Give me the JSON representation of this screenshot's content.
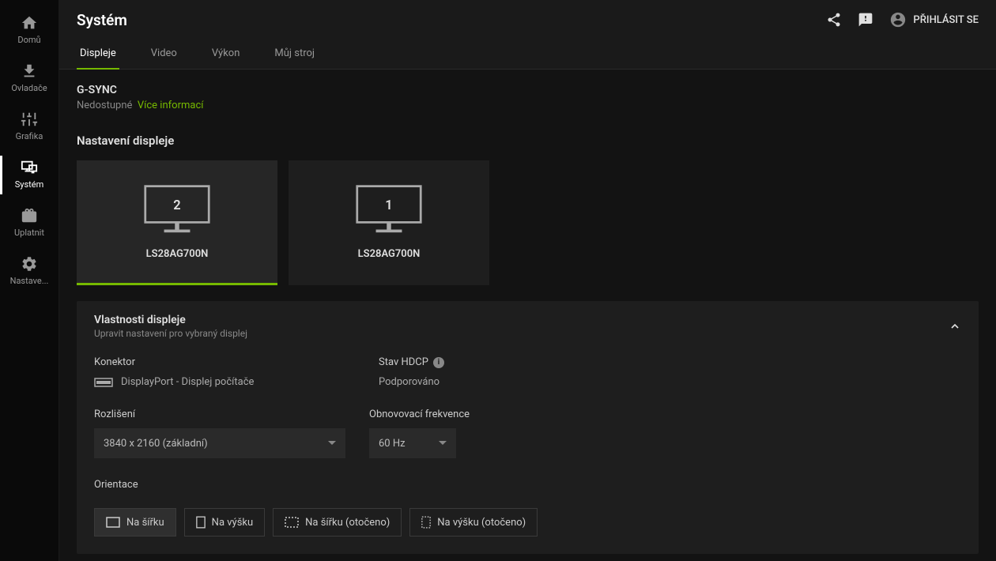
{
  "sidebar": {
    "items": [
      {
        "label": "Domů"
      },
      {
        "label": "Ovladače"
      },
      {
        "label": "Grafika"
      },
      {
        "label": "Systém"
      },
      {
        "label": "Uplatnit"
      },
      {
        "label": "Nastave..."
      }
    ]
  },
  "header": {
    "title": "Systém",
    "login_label": "PŘIHLÁSIT SE"
  },
  "tabs": [
    {
      "label": "Displeje"
    },
    {
      "label": "Video"
    },
    {
      "label": "Výkon"
    },
    {
      "label": "Můj stroj"
    }
  ],
  "gsync": {
    "title": "G-SYNC",
    "status": "Nedostupné",
    "link_label": "Více informací"
  },
  "displays_section": {
    "title": "Nastavení displeje",
    "cards": [
      {
        "number": "2",
        "name": "LS28AG700N"
      },
      {
        "number": "1",
        "name": "LS28AG700N"
      }
    ]
  },
  "panel": {
    "title": "Vlastnosti displeje",
    "sub": "Upravit nastavení pro vybraný displej",
    "connector_label": "Konektor",
    "connector_value": "DisplayPort - Displej počítače",
    "hdcp_label": "Stav HDCP",
    "hdcp_value": "Podporováno",
    "resolution_label": "Rozlišení",
    "resolution_value": "3840 x 2160 (základní)",
    "refresh_label": "Obnovovací frekvence",
    "refresh_value": "60 Hz",
    "orientation_label": "Orientace",
    "orientation_options": [
      {
        "label": "Na šířku"
      },
      {
        "label": "Na výšku"
      },
      {
        "label": "Na šířku (otočeno)"
      },
      {
        "label": "Na výšku (otočeno)"
      }
    ]
  }
}
